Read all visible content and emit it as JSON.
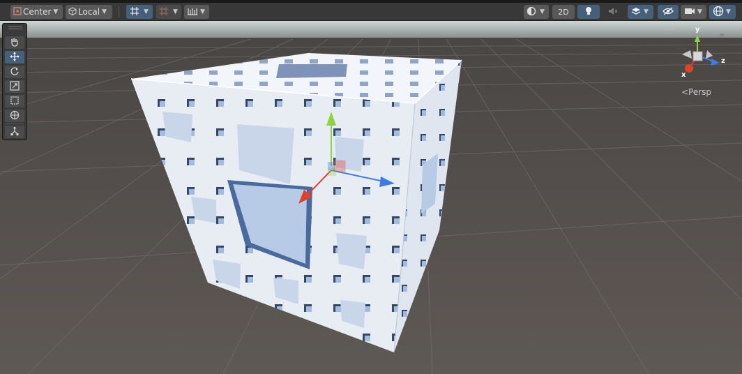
{
  "toolbar": {
    "pivot_mode": "Center",
    "pivot_rotation": "Local",
    "view_2d": "2D"
  },
  "gizmo": {
    "projection_label": "<Persp",
    "axis_y": "y",
    "axis_z": "z",
    "axis_x": "x"
  },
  "tools": [
    {
      "name": "hand",
      "icon": "hand-icon"
    },
    {
      "name": "move",
      "icon": "move-icon",
      "active": true
    },
    {
      "name": "rotate",
      "icon": "rotate-icon"
    },
    {
      "name": "scale",
      "icon": "scale-icon"
    },
    {
      "name": "rect",
      "icon": "rect-icon"
    },
    {
      "name": "transform",
      "icon": "transform-icon"
    },
    {
      "name": "custom",
      "icon": "custom-editor-tool-icon"
    }
  ],
  "colors": {
    "accent": "#46607c",
    "axis_x": "#e0412a",
    "axis_y": "#8cd33c",
    "axis_z": "#3c7ce8",
    "ground": "#5a5552",
    "sky": "#cfd6d6",
    "cube": "#e8edf3"
  }
}
